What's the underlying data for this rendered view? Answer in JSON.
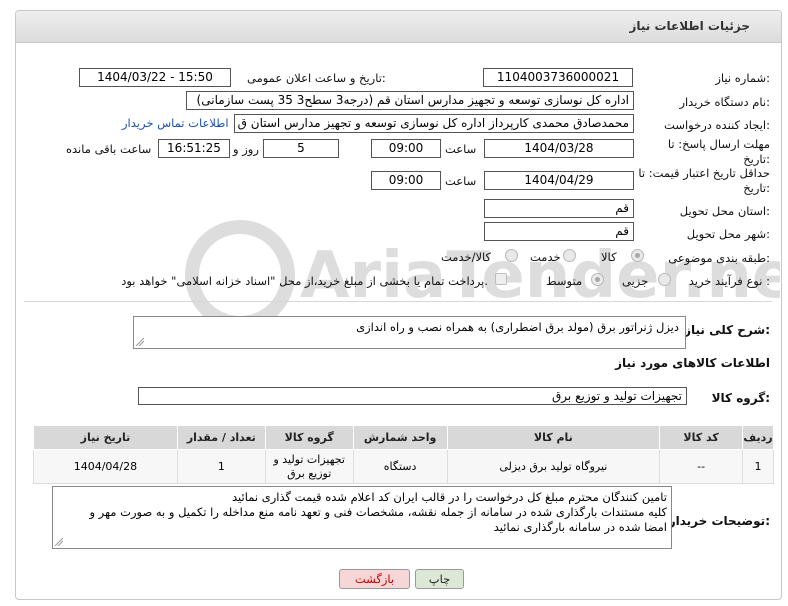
{
  "header": {
    "title": "جزئیات اطلاعات نیاز"
  },
  "labels": {
    "need_number": "شماره نیاز:",
    "announce_datetime": "تاریخ و ساعت اعلان عمومی:",
    "buyer_org": "نام دستگاه خریدار:",
    "requester": "ایجاد کننده درخواست:",
    "reply_deadline": "مهلت ارسال پاسخ: تا تاریخ:",
    "price_validity": "حداقل تاریخ اعتبار قیمت: تا تاریخ:",
    "delivery_province": "استان محل تحویل:",
    "delivery_city": "شهر محل تحویل:",
    "category": "طبقه بندی موضوعی:",
    "purchase_type": "نوع فرآیند خرید :",
    "time": "ساعت",
    "day_and": "روز و",
    "remaining": "ساعت باقی مانده",
    "need_desc": "شرح کلی نیاز:",
    "goods_info": "اطلاعات کالاهای مورد نیاز",
    "goods_group": "گروه کالا:",
    "buyer_notes": "توضیحات خریدار:"
  },
  "fields": {
    "need_number": "1104003736000021",
    "announce_datetime": "1404/03/22 - 15:50",
    "buyer_org": "اداره کل نوسازی   توسعه و تجهیز مدارس استان قم (درجه3 سطح3  35 پست سازمانی)",
    "requester": "محمدصادق محمدی کارپرداز  اداره کل نوسازی   توسعه و تجهیز مدارس استان ق",
    "contact_link": "اطلاعات تماس خریدار",
    "reply_date": "1404/03/28",
    "reply_time": "09:00",
    "days_left": "5",
    "time_left": "16:51:25",
    "validity_date": "1404/04/29",
    "validity_time": "09:00",
    "province": "قم",
    "city": "قم",
    "need_desc": "دیزل ژنراتور برق (مولد برق اضطراری) به همراه نصب و راه اندازی",
    "goods_group": "تجهیزات تولید و توزیع برق"
  },
  "category_options": [
    {
      "label": "کالا",
      "selected": true
    },
    {
      "label": "خدمت",
      "selected": false
    },
    {
      "label": "کالا/خدمت",
      "selected": false
    }
  ],
  "purchase_options": [
    {
      "label": "جزیی",
      "selected": false
    },
    {
      "label": "متوسط",
      "selected": true
    }
  ],
  "payment_note": "پرداخت تمام یا بخشی از مبلغ خرید،از محل \"اسناد خزانه اسلامی\" خواهد بود.",
  "table": {
    "headers": [
      "ردیف",
      "کد کالا",
      "نام کالا",
      "واحد شمارش",
      "گروه کالا",
      "تعداد / مقدار",
      "تاریخ نیاز"
    ],
    "rows": [
      [
        "1",
        "--",
        "نیروگاه تولید برق دیزلی",
        "دستگاه",
        "تجهیزات تولید و توزیع برق",
        "1",
        "1404/04/28"
      ]
    ]
  },
  "buyer_notes": [
    "تامین کنندگان محترم مبلغ کل درخواست را در قالب ایران کد اعلام شده قیمت گذاری نمائید",
    "کلیه مستندات بارگذاری شده در سامانه از جمله نقشه، مشخصات فنی و تعهد نامه منع مداخله را تکمیل و به صورت مهر و",
    "امضا شده در سامانه بارگذاری نمائید"
  ],
  "buttons": {
    "print": "چاپ",
    "back": "بازگشت"
  },
  "watermark": "AriaTender.net",
  "colors": {
    "link": "#1a4fb5",
    "back_button_bg": "#f6d6d6",
    "back_button_text": "#cc0000",
    "print_button_bg": "#dde7d6"
  }
}
